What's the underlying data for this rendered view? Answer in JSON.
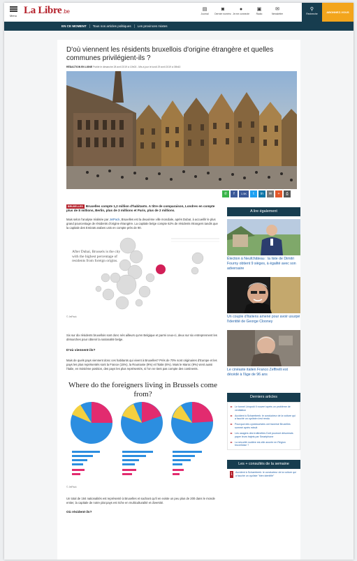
{
  "header": {
    "menu_label": "Menu",
    "logo_main": "La Libre",
    "logo_suffix": ".be",
    "nav": [
      {
        "label": "Journal",
        "icon": "newspaper-icon",
        "glyph": "▤"
      },
      {
        "label": "Dernier numéro",
        "icon": "camera-icon",
        "glyph": "◙"
      },
      {
        "label": "Je me connecte",
        "icon": "user-icon",
        "glyph": "●"
      },
      {
        "label": "Radio",
        "icon": "radio-icon",
        "glyph": "▣"
      },
      {
        "label": "Newsletter",
        "icon": "mail-icon",
        "glyph": "✉"
      }
    ],
    "search_label": "Recherche",
    "search_glyph": "⚲",
    "cta_label": "ABONNEZ-VOUS"
  },
  "subnav": {
    "now_label": "EN CE MOMENT",
    "items": [
      "Tous nos articles politiques",
      "Les provinces mixtes"
    ]
  },
  "article": {
    "title": "D'où viennent les résidents bruxellois d'origine étrangère et quelles communes privilégient-ils ?",
    "byline_author": "RÉDACTION EN LIGNE",
    "byline_date": "Publié le dimanche 28 avril 2019 à 10h03 - Mis à jour le lundi 29 avril 2019 à 08h43",
    "share": [
      {
        "icon": "whatsapp-icon",
        "glyph": "✆",
        "color": "#3ab54a"
      },
      {
        "icon": "facebook-icon",
        "glyph": "f",
        "color": "#3b5998"
      },
      {
        "icon": "count-icon",
        "glyph": "1.5K",
        "color": "#3b5998"
      },
      {
        "icon": "twitter-icon",
        "glyph": "t",
        "color": "#1da1f2"
      },
      {
        "icon": "linkedin-icon",
        "glyph": "in",
        "color": "#0e76a8"
      },
      {
        "icon": "email-icon",
        "glyph": "✉",
        "color": "#777777"
      },
      {
        "icon": "plus-icon",
        "glyph": "+",
        "color": "#e3572a"
      },
      {
        "icon": "print-icon",
        "glyph": "⎙",
        "color": "#555555"
      }
    ],
    "tag": "BRUXELLES",
    "lead": "Bruxelles compte 1,2 million d'habitants. A titre de comparaison, Londres en compte plus de 8 millions, Berlin, plus de 3 millions et Paris, plus de 2 millions.",
    "p1_prefix": "Mais selon l'analyse réalisée par ",
    "p1_link": "JetPack",
    "p1_rest": ", Bruxelles est la deuxième ville mondiale, après Dubaï, à accueillir le plus grand pourcentage de résidents d'origine étrangère. La capitale belge compte 62% de résidents étrangers tandis que la capitale des Emirats arabes unis en compte près de 90.",
    "chart1_annot": "After Dubai, Brussels is the city with the highest percentage of residents from foreign origins.",
    "chart1_credit": "© JetPack",
    "p2": "Six sur dix résidents bruxellois sont donc nés ailleurs qu'en Belgique et parmi ceux-ci, deux sur six entreprennent les démarches pour obtenir la nationalité belge.",
    "h_where_from": "D'où viennent-ils?",
    "p3": "Mais de quels pays viennent donc ces habitants qui vivent à Bruxelles? Près de 70% sont originaires d'Europe et les pays les plus représentés sont la France (15%), la Roumanie (9%) et l'Italie (6%). Mais le Maroc (9%) vient aussi l'italie, en troisième position, des pays les plus représentés, si l'on ne tient pas compte des continents.",
    "chart2_title": "Where do the foreigners living in Brussels come from?",
    "chart2_credit": "© JetPack",
    "p4": "Un total de 184 nationalités est représenté à Bruxelles et sachant qu'il en existe un peu plus de 200 dans le monde entier, la capitale de notre plat pays est riche en multiculturalité et diversité.",
    "h_where_live": "Où résident-ils?"
  },
  "sidebar": {
    "read_also_title": "A lire également",
    "read_also": [
      {
        "title": "Élection à Neufchâteau : la liste de Dimitri Fourny obtient 9 sièges, à égalité avec son adversaire"
      },
      {
        "title": "Un couple d'Italiens amené pour avoir usurpé l'identité de George Clooney"
      },
      {
        "title": "Le cinéaste italien Franco Zeffirelli est décédé à l'âge de 96 ans"
      }
    ],
    "latest_title": "Derniers articles",
    "latest": [
      "Le tunnel Léopold II rouvert après un problème de ventilation",
      "Accident à Schaerbeek: le conducteur de la voiture qui a fauché un cycliste s'est rendu",
      "Pourquoi des cyclotouristes ont traversé Bruxelles sommé après minuit",
      "Les usagers des trottinettes Dott pourront désormais payer leurs trajets par Smartphone",
      "La sécurité routière est-elle ancrée en Région bruxelloise ?"
    ],
    "consult_title": "Les + consultés de la semaine",
    "consult_first": "Accident à Schaerbeek: le conducteur de la voiture qui a fauché un cycliste \"bien identifié\"",
    "consult_num": "1"
  },
  "colors": {
    "navy": "#173d4f",
    "red": "#b4202a",
    "orange": "#f3a51c",
    "link": "#1e5fa8"
  }
}
